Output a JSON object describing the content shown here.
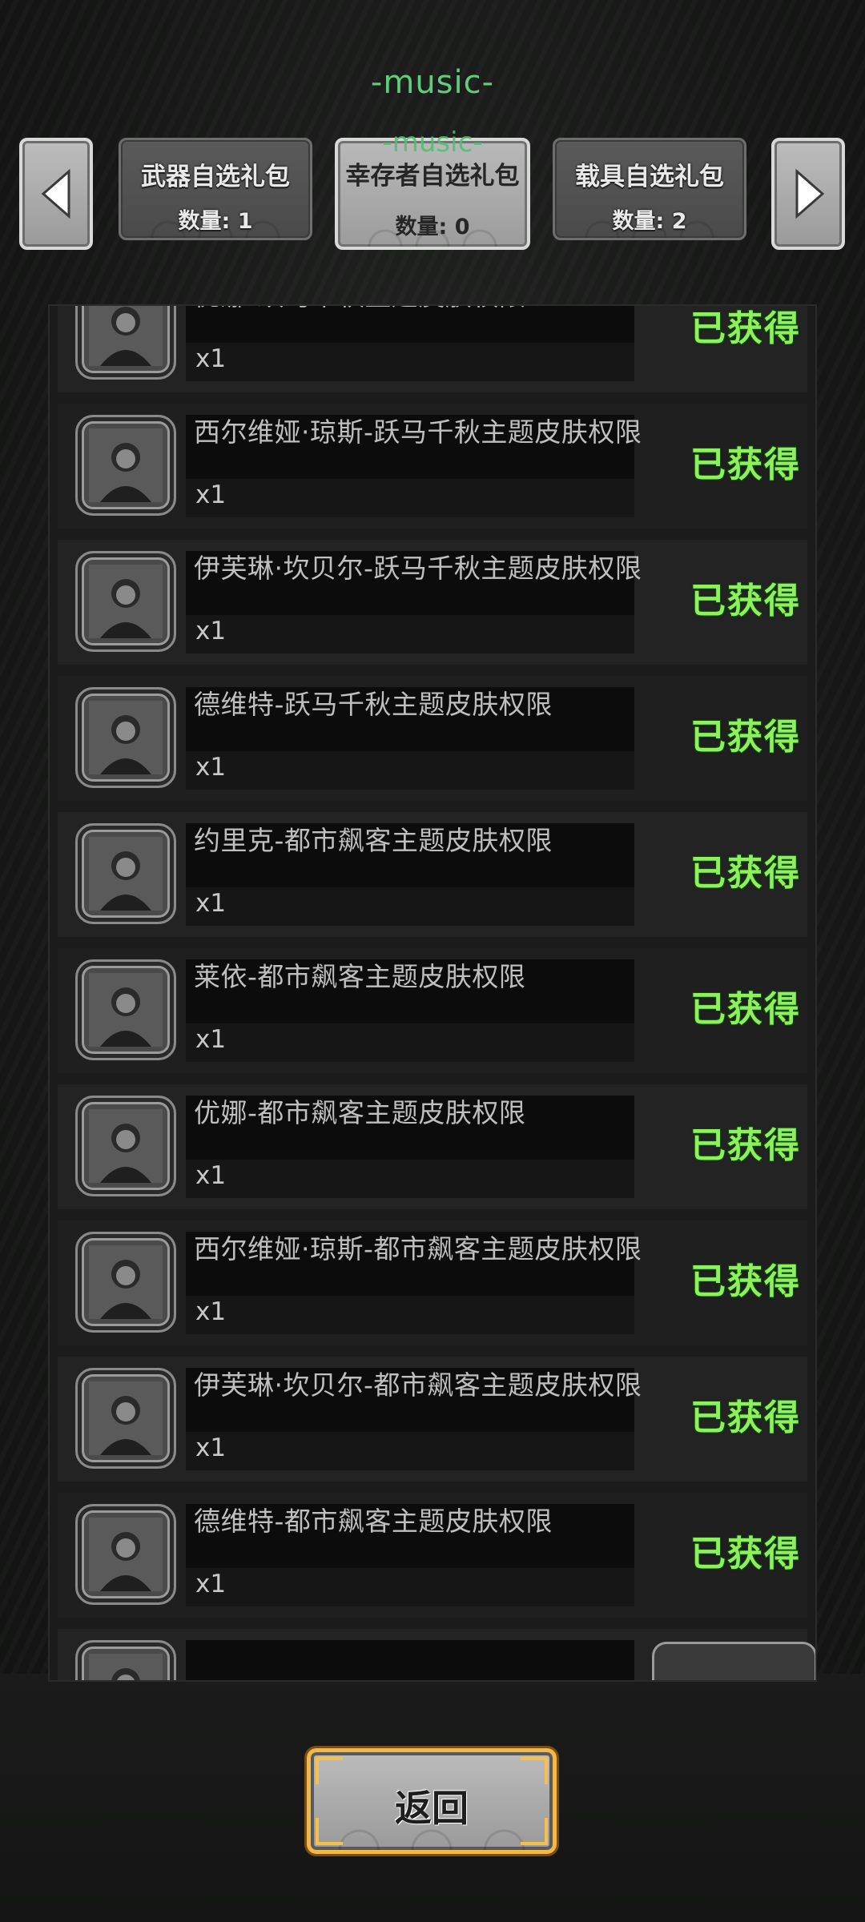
{
  "header": {
    "music_label": "-music-",
    "music_overlay": "-music-"
  },
  "tabs": [
    {
      "name": "武器自选礼包",
      "count": "数量: 1",
      "active": false
    },
    {
      "name": "幸存者自选礼包",
      "count": "数量: 0",
      "active": true
    },
    {
      "name": "载具自选礼包",
      "count": "数量: 2",
      "active": false
    }
  ],
  "icons": {
    "prev": "chevron-left-icon",
    "next": "chevron-right-icon"
  },
  "items": [
    {
      "name": "优娜-跃马千秋主题皮肤权限",
      "qty": "x1",
      "status": "已获得"
    },
    {
      "name": "西尔维娅·琼斯-跃马千秋主题皮肤权限",
      "qty": "x1",
      "status": "已获得"
    },
    {
      "name": "伊芙琳·坎贝尔-跃马千秋主题皮肤权限",
      "qty": "x1",
      "status": "已获得"
    },
    {
      "name": "德维特-跃马千秋主题皮肤权限",
      "qty": "x1",
      "status": "已获得"
    },
    {
      "name": "约里克-都市飙客主题皮肤权限",
      "qty": "x1",
      "status": "已获得"
    },
    {
      "name": "莱依-都市飙客主题皮肤权限",
      "qty": "x1",
      "status": "已获得"
    },
    {
      "name": "优娜-都市飙客主题皮肤权限",
      "qty": "x1",
      "status": "已获得"
    },
    {
      "name": "西尔维娅·琼斯-都市飙客主题皮肤权限",
      "qty": "x1",
      "status": "已获得"
    },
    {
      "name": "伊芙琳·坎贝尔-都市飙客主题皮肤权限",
      "qty": "x1",
      "status": "已获得"
    },
    {
      "name": "德维特-都市飙客主题皮肤权限",
      "qty": "x1",
      "status": "已获得"
    }
  ],
  "footer": {
    "back_label": "返回"
  },
  "colors": {
    "accent_green": "#8df05c",
    "music_green": "#5fce7a",
    "gold_border": "#f1b84a"
  }
}
